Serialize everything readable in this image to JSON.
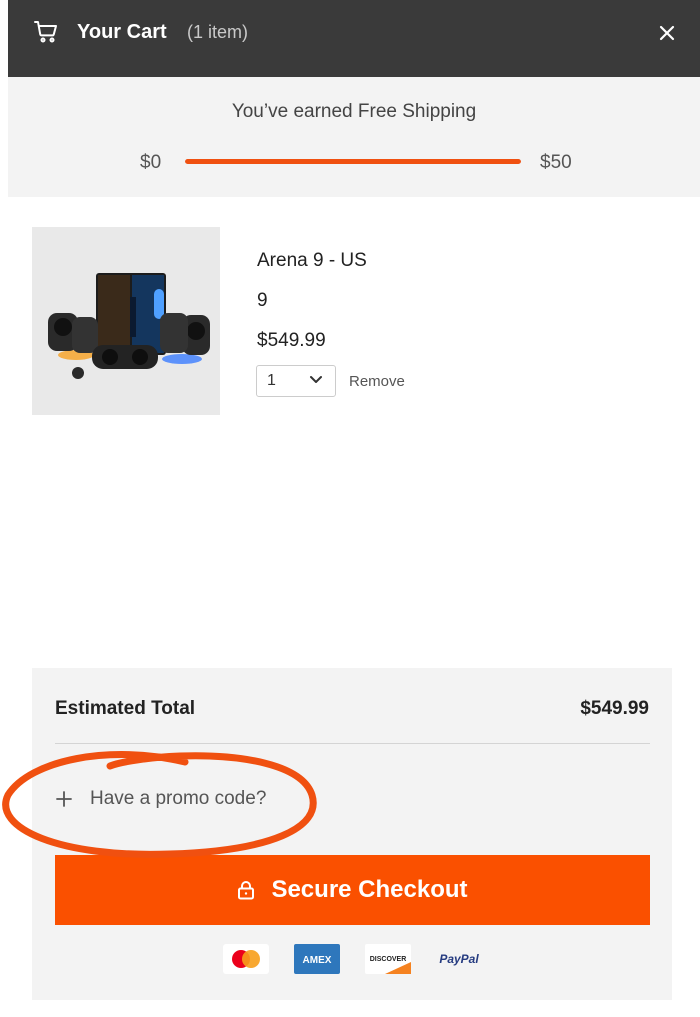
{
  "header": {
    "title": "Your Cart",
    "count": "(1 item)",
    "icons": {
      "cart": "cart-icon",
      "close": "close-icon"
    }
  },
  "shipping": {
    "message": "You’ve earned Free Shipping",
    "min_label": "$0",
    "max_label": "$50",
    "progress_fraction": 1.0,
    "bar_color": "#f05010"
  },
  "items": [
    {
      "name": "Arena 9 - US",
      "variant": "9",
      "price": "$549.99",
      "quantity": "1",
      "remove_label": "Remove"
    }
  ],
  "summary": {
    "estimated_total_label": "Estimated Total",
    "estimated_total_value": "$549.99",
    "promo_label": "Have a promo code?",
    "checkout_label": "Secure Checkout",
    "accent_color": "#fa5000",
    "payment_methods": [
      "mastercard",
      "amex",
      "discover",
      "paypal"
    ],
    "payment_text": {
      "amex": "AMEX",
      "discover": "DISCOVER",
      "paypal": "PayPal"
    }
  },
  "annotation_color": "#f05010"
}
